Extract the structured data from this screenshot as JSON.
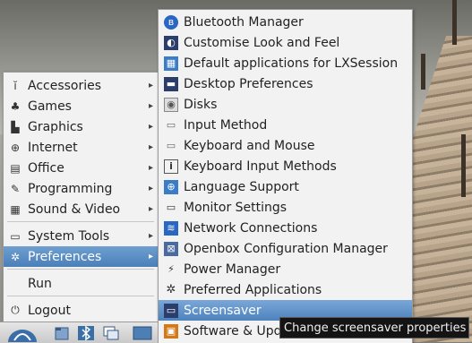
{
  "main_menu": {
    "items": [
      {
        "label": "Accessories",
        "icon": "accessories-icon",
        "glyph": "ĭ",
        "submenu": true
      },
      {
        "label": "Games",
        "icon": "games-icon",
        "glyph": "♣",
        "submenu": true
      },
      {
        "label": "Graphics",
        "icon": "graphics-icon",
        "glyph": "▙",
        "submenu": true
      },
      {
        "label": "Internet",
        "icon": "globe-icon",
        "glyph": "⊕",
        "submenu": true
      },
      {
        "label": "Office",
        "icon": "document-icon",
        "glyph": "▤",
        "submenu": true
      },
      {
        "label": "Programming",
        "icon": "programming-icon",
        "glyph": "✎",
        "submenu": true
      },
      {
        "label": "Sound & Video",
        "icon": "film-icon",
        "glyph": "▦",
        "submenu": true
      },
      {
        "label": "System Tools",
        "icon": "monitor-icon",
        "glyph": "▭",
        "submenu": true
      },
      {
        "label": "Preferences",
        "icon": "gear-icon",
        "glyph": "✲",
        "submenu": true,
        "selected": true
      },
      {
        "label": "Run",
        "icon": "",
        "glyph": "",
        "submenu": false
      },
      {
        "label": "Logout",
        "icon": "logout-icon",
        "glyph": "⏻",
        "submenu": false
      }
    ],
    "arrow": "▸"
  },
  "preferences_menu": {
    "items": [
      {
        "label": "Bluetooth Manager",
        "icon": "bluetooth-icon",
        "glyph": "ʙ",
        "color": "#2a66c4"
      },
      {
        "label": "Customise Look and Feel",
        "icon": "appearance-icon",
        "glyph": "◐",
        "color": "#2b3d6a"
      },
      {
        "label": "Default applications for LXSession",
        "icon": "default-apps-icon",
        "glyph": "▦",
        "color": "#3a7cc8"
      },
      {
        "label": "Desktop Preferences",
        "icon": "desktop-icon",
        "glyph": "▬",
        "color": "#2b3d6a"
      },
      {
        "label": "Disks",
        "icon": "disks-icon",
        "glyph": "◉",
        "color": "#555555"
      },
      {
        "label": "Input Method",
        "icon": "keyboard-icon",
        "glyph": "▭",
        "color": "#666666"
      },
      {
        "label": "Keyboard and Mouse",
        "icon": "keyboard-mouse-icon",
        "glyph": "▭",
        "color": "#666666"
      },
      {
        "label": "Keyboard Input Methods",
        "icon": "info-icon",
        "glyph": "i",
        "color": "#444444"
      },
      {
        "label": "Language Support",
        "icon": "language-icon",
        "glyph": "⊕",
        "color": "#3a7cc8"
      },
      {
        "label": "Monitor Settings",
        "icon": "monitor-icon",
        "glyph": "▭",
        "color": "#333333"
      },
      {
        "label": "Network Connections",
        "icon": "wifi-icon",
        "glyph": "≋",
        "color": "#2a66c4"
      },
      {
        "label": "Openbox Configuration Manager",
        "icon": "openbox-icon",
        "glyph": "⊠",
        "color": "#4a6aa0"
      },
      {
        "label": "Power Manager",
        "icon": "power-icon",
        "glyph": "⚡",
        "color": "#333333"
      },
      {
        "label": "Preferred Applications",
        "icon": "gear-icon",
        "glyph": "✲",
        "color": "#333333"
      },
      {
        "label": "Screensaver",
        "icon": "screensaver-icon",
        "glyph": "▭",
        "color": "#2b3d6a",
        "selected": true
      },
      {
        "label": "Software & Upd",
        "icon": "software-update-icon",
        "glyph": "▣",
        "color": "#d27a1a"
      }
    ]
  },
  "tooltip": {
    "text": "Change screensaver properties"
  },
  "panel": {
    "menu_button_icon": "lxde-menu-icon",
    "launchers": [
      "file-manager-icon",
      "bluetooth-panel-icon",
      "windows-icon",
      "desktop-switch-icon"
    ]
  },
  "colors": {
    "selection": "#4d82bd",
    "menu_bg": "#f2f2f2",
    "tooltip_bg": "#141414"
  }
}
